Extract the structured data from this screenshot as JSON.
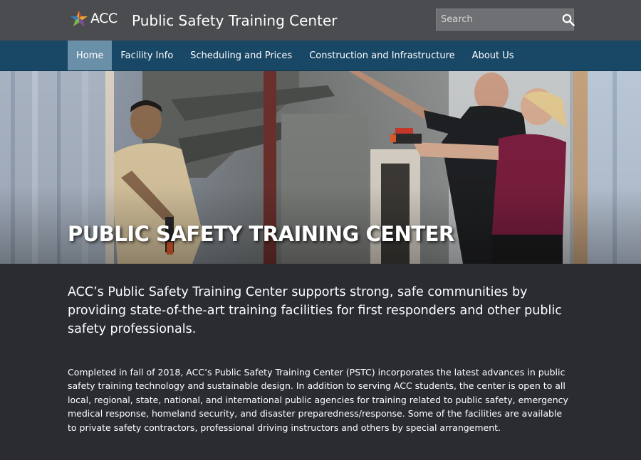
{
  "header": {
    "logo_text": "ACC",
    "site_title": "Public Safety Training Center",
    "search_placeholder": "Search"
  },
  "nav": {
    "items": [
      {
        "label": "Home",
        "active": true
      },
      {
        "label": "Facility Info",
        "active": false
      },
      {
        "label": "Scheduling and Prices",
        "active": false
      },
      {
        "label": "Construction and Infrastructure",
        "active": false
      },
      {
        "label": "About Us",
        "active": false
      }
    ]
  },
  "hero": {
    "title": "PUBLIC SAFETY TRAINING CENTER"
  },
  "main": {
    "lead": "ACC’s Public Safety Training Center supports strong, safe communities by providing state-of-the-art training facilities for first responders and other public safety professionals.",
    "body": "Completed in fall of 2018, ACC’s Public Safety Training Center (PSTC) incorporates the latest advances in public safety training technology and sustainable design. In addition to serving ACC students, the center is open to all local, regional, state, national, and international public agencies for training related to public safety, emergency medical response, homeland security, and disaster preparedness/response. Some of the facilities are available to private safety contractors, professional driving instructors and others by special arrangement."
  },
  "colors": {
    "topbar": "#4b4c4f",
    "navbar": "#194766",
    "nav_active": "#6a8fa8",
    "page_bg": "#2a2c32"
  }
}
